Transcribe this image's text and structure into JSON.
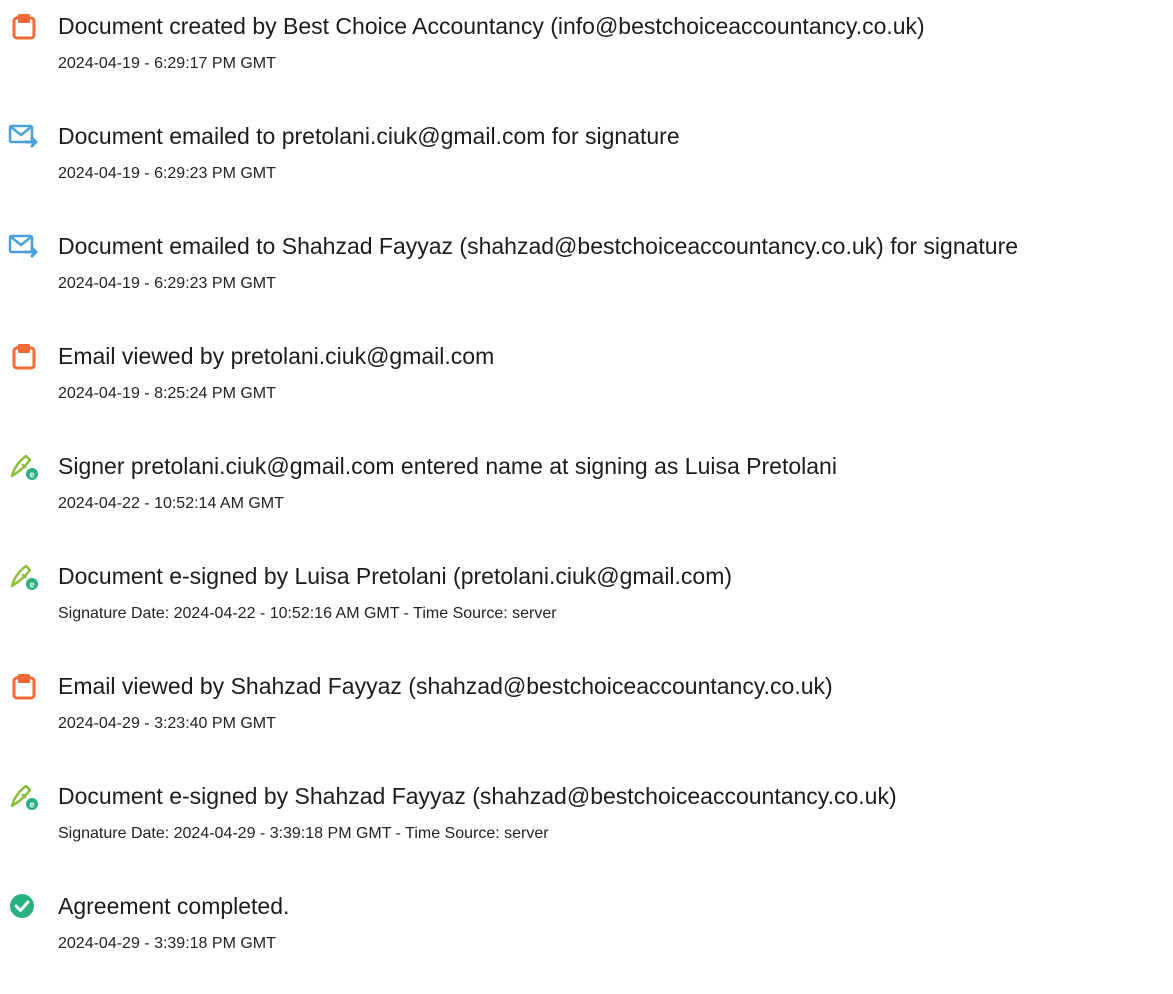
{
  "colors": {
    "doc_icon": "#ef6a36",
    "email_icon": "#4aa0d8",
    "sign_icon_pen": "#8bbf3a",
    "sign_icon_badge": "#2bb07f",
    "complete_icon": "#2bb07f"
  },
  "events": [
    {
      "icon": "document-icon",
      "text": "Document created by Best Choice Accountancy (info@bestchoiceaccountancy.co.uk)",
      "date": "2024-04-19 - 6:29:17 PM GMT"
    },
    {
      "icon": "email-sent-icon",
      "text": "Document emailed to pretolani.ciuk@gmail.com for signature",
      "date": "2024-04-19 - 6:29:23 PM GMT"
    },
    {
      "icon": "email-sent-icon",
      "text": "Document emailed to Shahzad Fayyaz (shahzad@bestchoiceaccountancy.co.uk) for signature",
      "date": "2024-04-19 - 6:29:23 PM GMT"
    },
    {
      "icon": "document-icon",
      "text": "Email viewed by pretolani.ciuk@gmail.com",
      "date": "2024-04-19 - 8:25:24 PM GMT"
    },
    {
      "icon": "signature-pen-icon",
      "text": "Signer pretolani.ciuk@gmail.com entered name at signing as Luisa Pretolani",
      "date": "2024-04-22 - 10:52:14 AM GMT"
    },
    {
      "icon": "signature-pen-icon",
      "text": "Document e-signed by Luisa Pretolani (pretolani.ciuk@gmail.com)",
      "date": "Signature Date: 2024-04-22 - 10:52:16 AM GMT - Time Source: server"
    },
    {
      "icon": "document-icon",
      "text": "Email viewed by Shahzad Fayyaz (shahzad@bestchoiceaccountancy.co.uk)",
      "date": "2024-04-29 - 3:23:40 PM GMT"
    },
    {
      "icon": "signature-pen-icon",
      "text": "Document e-signed by Shahzad Fayyaz (shahzad@bestchoiceaccountancy.co.uk)",
      "date": "Signature Date: 2024-04-29 - 3:39:18 PM GMT - Time Source: server"
    },
    {
      "icon": "checkmark-circle-icon",
      "text": "Agreement completed.",
      "date": "2024-04-29 - 3:39:18 PM GMT"
    }
  ]
}
